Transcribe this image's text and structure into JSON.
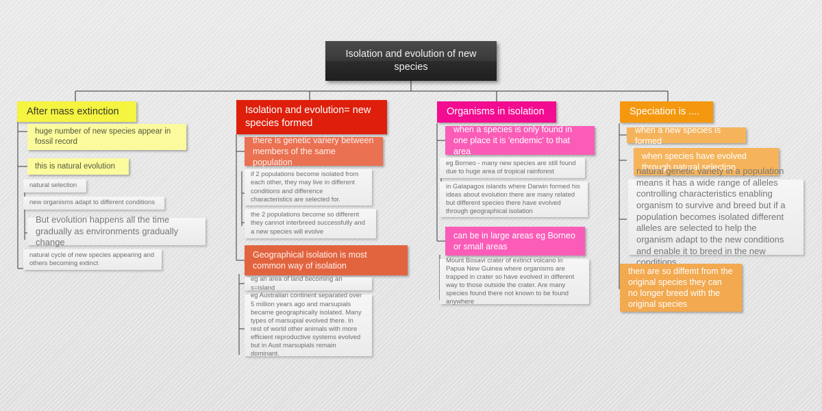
{
  "diagram": {
    "type": "mind-map",
    "root": {
      "label": "Isolation and evolution of new species",
      "color": "#2b2b2b"
    },
    "branches": [
      {
        "id": "after-mass-extinction",
        "label": "After mass extinction",
        "color": "#f4f441",
        "children": [
          {
            "label": "huge number of new species appear in fossil record",
            "color": "#fbfb9e",
            "style": "yellow-sub"
          },
          {
            "label": "this is natural evolution",
            "color": "#fbfb9e",
            "style": "yellow-sub"
          },
          {
            "label": "natural selection",
            "color": "#f0f0f0",
            "style": "grey"
          },
          {
            "label": "new organisms adapt to different conditions",
            "color": "#f0f0f0",
            "style": "grey"
          },
          {
            "label": "But evolution happens all the time gradually as environments gradually change",
            "color": "#f0f0f0",
            "style": "grey-lg"
          },
          {
            "label": "natural cycle of new species appearing and others becoming extinct",
            "color": "#f0f0f0",
            "style": "grey-md"
          }
        ]
      },
      {
        "id": "isolation-and-evolution",
        "label": "Isolation and evolution= new species formed",
        "color": "#dd1f0c",
        "children": [
          {
            "label": "there is genetic variery between members of the same population",
            "color": "#ea7152",
            "style": "red-sub"
          },
          {
            "label": "if 2 populations become isolated from each other, they may live in different conditions and difference characteristics are selected for.",
            "color": "#f0f0f0",
            "style": "grey"
          },
          {
            "label": "the 2 populations become so different they cannot interbreed successfully and a new species  will evolve",
            "color": "#f0f0f0",
            "style": "grey"
          },
          {
            "label": "Geographical isolation is most common way of isolation",
            "color": "#e2643f",
            "style": "red-sub2"
          },
          {
            "label": "eg an area of land becoming an s=island",
            "color": "#f0f0f0",
            "style": "grey"
          },
          {
            "label": "eg Australian continent separated  over 5 million years ago and marsupials became geographically isolated. Many types of marsupial evolved there. In rest of world other animals with more efficient reproductive systems evolved but in Aust marsupials remain dominant.",
            "color": "#f0f0f0",
            "style": "grey"
          }
        ]
      },
      {
        "id": "organisms-in-isolation",
        "label": "Organisms in isolation",
        "color": "#f20c90",
        "children": [
          {
            "label": "when a species is only found in one place it is 'endemic' to that area",
            "color": "#fa5cb8",
            "style": "pink-sub"
          },
          {
            "label": "eg Borneo - many new species are still found due to huge area of tropical rainforest",
            "color": "#f0f0f0",
            "style": "grey"
          },
          {
            "label": "in Galapagos islands where Darwin formed his ideas about evolution there are many related but different species there have evolved through geographical isolation",
            "color": "#f0f0f0",
            "style": "grey"
          },
          {
            "label": "can be in large areas eg Borneo or small areas",
            "color": "#fa5cb8",
            "style": "pink-sub"
          },
          {
            "label": "Mount Bosavi crater of extinct volcano in Papua New Guinea where organisms are trapped in crater so have evolved in different way to those outside the crater. Are many species found there not known to be found anywhere",
            "color": "#f0f0f0",
            "style": "grey"
          }
        ]
      },
      {
        "id": "speciation",
        "label": "Speciation is ....",
        "color": "#f4980f",
        "children": [
          {
            "label": "when a new species is formed",
            "color": "#f5b45c",
            "style": "orange-sub"
          },
          {
            "label": "when species have evolved through natural selection",
            "color": "#f5b45c",
            "style": "orange-sub"
          },
          {
            "label": "natural genetic variety in a population means it has a wide range of alleles controlling characteristics enabling organism to survive and breed but if  a population becomes isolated different alleles are selected to help the organism adapt to the new conditions and enable it to breed in the new conditions",
            "color": "#f0f0f0",
            "style": "grey-lg"
          },
          {
            "label": "then are so diffemt from the original species they can no longer breed with the original species",
            "color": "#f2a94f",
            "style": "orange-sub2"
          }
        ]
      }
    ],
    "connector_color": "#555555"
  }
}
